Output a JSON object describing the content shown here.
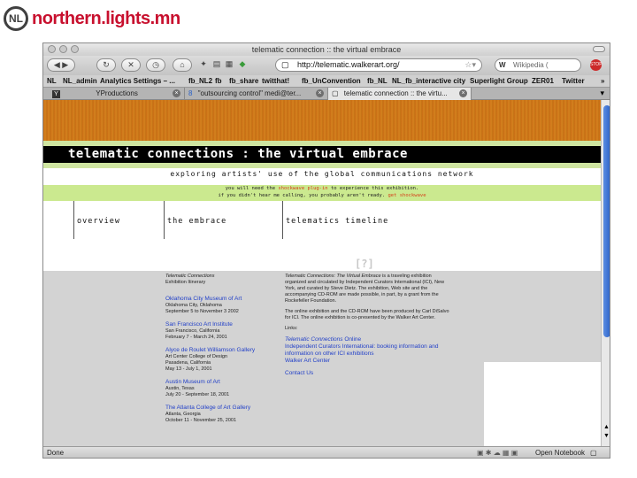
{
  "slide": {
    "logo_initials": "NL",
    "logo_text": "northern.lights.mn"
  },
  "browser": {
    "window_title": "telematic connection :: the virtual embrace",
    "url": "http://telematic.walkerart.org/",
    "search_placeholder": "Wikipedia (",
    "search_prefix": "W",
    "bookmarks": [
      "NL",
      "NL_admin",
      "Analytics Settings – ...",
      "fb_NL2",
      "fb",
      "fb_share",
      "twitthat!",
      "fb_UnConvention",
      "fb_NL",
      "NL_fb_interactive city",
      "Superlight Group",
      "ZER01",
      "Twitter",
      "»"
    ],
    "tabs": [
      {
        "icon": "Y",
        "label": "YProductions"
      },
      {
        "icon": "8",
        "label": "\"outsourcing control\" medi@ter..."
      },
      {
        "icon": "",
        "label": "telematic connection :: the virtu..."
      }
    ],
    "status_text": "Done",
    "status_right": "Open Notebook"
  },
  "page": {
    "banner_title": "telematic connections : the virtual embrace",
    "subtitle": "exploring artists' use of the global communications network",
    "notice": {
      "line1_a": "you will need the",
      "line1_link": "shockwave plug-in",
      "line1_b": "to experience this exhibition.",
      "line2_a": "if you didn't hear me calling, you probably aren't ready.",
      "line2_link": "get shockwave"
    },
    "nav": [
      "overview",
      "the embrace",
      "telematics timeline"
    ],
    "qmark": "[?]",
    "itinerary": {
      "title": "Telematic Connections",
      "subtitle": "Exhibition Itinerary",
      "venues": [
        {
          "name": "Oklahoma City Museum of Art",
          "details": [
            "Oklahoma City, Oklahoma",
            "September 5 to November 3 2002"
          ]
        },
        {
          "name": "San Francisco Art Institute",
          "details": [
            "San Francisco, California",
            "February 7 - March 24, 2001"
          ]
        },
        {
          "name": "Alyce de Roulet Williamson Gallery",
          "details": [
            "Art Center College of Design",
            "Pasadena, California",
            "May 13 - July 1, 2001"
          ]
        },
        {
          "name": "Austin Museum of Art",
          "details": [
            "Austin, Texas",
            "July 20 - September 18, 2001"
          ]
        },
        {
          "name": "The Atlanta College of Art Gallery",
          "details": [
            "Atlanta, Georgia",
            "October 11 - November 25, 2001"
          ]
        }
      ]
    },
    "about": {
      "p1_title": "Telematic Connections: The Virtual Embrace",
      "p1_rest": "is a traveling exhibition organized and circulated by Independent Curators International (ICI), New York, and curated by Steve Dietz. The exhibition, Web site and the accompanying CD-ROM are made possible, in part, by a grant from the Rockefeller Foundation.",
      "p2": "The online exhibition and the CD-ROM have been produced by Carl DiSalvo for ICI. The online exhibition is co-presented by the Walker Art Center.",
      "links_label": "Links:",
      "link1_italic": "Telematic Connections",
      "link1_rest": "Online",
      "link2": "Independent Curators International: booking information and information on other ICI exhibitions",
      "link3": "Walker Art Center",
      "link4": "Contact Us"
    }
  }
}
